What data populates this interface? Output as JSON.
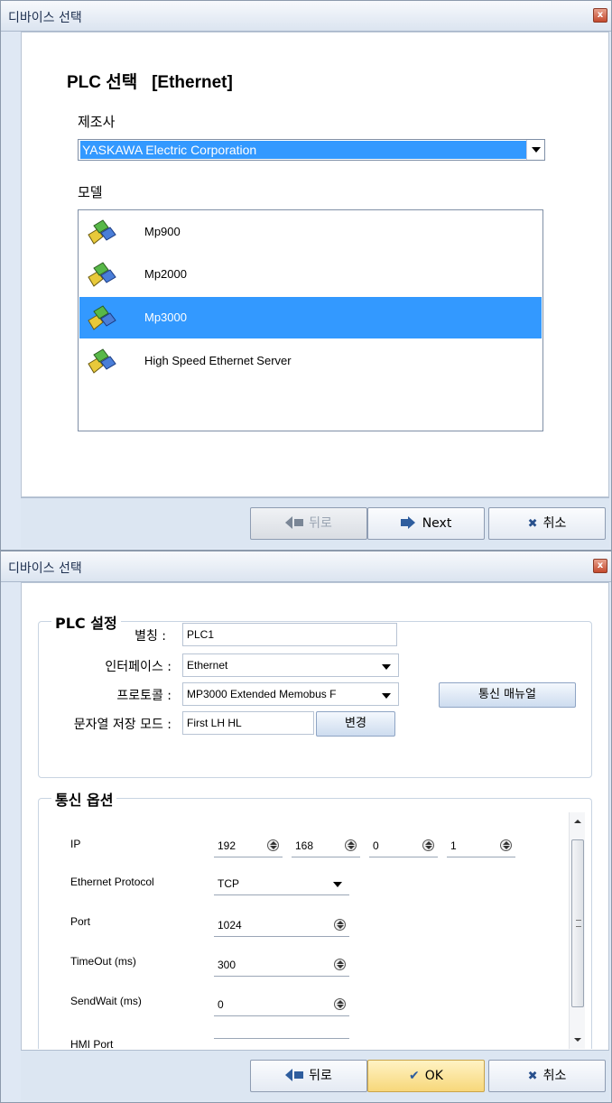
{
  "window1": {
    "title": "디바이스 선택",
    "heading": "PLC 선택   [Ethernet]",
    "manufacturer_label": "제조사",
    "manufacturer_value": "YASKAWA Electric Corporation",
    "model_label": "모델",
    "models": [
      {
        "name": "Mp900",
        "selected": false
      },
      {
        "name": "Mp2000",
        "selected": false
      },
      {
        "name": "Mp3000",
        "selected": true
      },
      {
        "name": "High Speed Ethernet Server",
        "selected": false
      }
    ],
    "buttons": {
      "back": "뒤로",
      "next": "Next",
      "cancel": "취소"
    }
  },
  "window2": {
    "title": "디바이스 선택",
    "plc_group_title": "PLC 설정",
    "alias_label": "별칭 :",
    "alias_value": "PLC1",
    "interface_label": "인터페이스 :",
    "interface_value": "Ethernet",
    "protocol_label": "프로토콜 :",
    "protocol_value": "MP3000 Extended Memobus F",
    "manual_button": "통신 매뉴얼",
    "string_mode_label": "문자열 저장 모드 :",
    "string_mode_value": "First LH HL",
    "change_button": "변경",
    "comm_group_title": "통신 옵션",
    "options": {
      "ip_label": "IP",
      "ip": [
        "192",
        "168",
        "0",
        "1"
      ],
      "eth_protocol_label": "Ethernet Protocol",
      "eth_protocol_value": "TCP",
      "port_label": "Port",
      "port_value": "1024",
      "timeout_label": "TimeOut (ms)",
      "timeout_value": "300",
      "sendwait_label": "SendWait (ms)",
      "sendwait_value": "0",
      "hmiport_label": "HMI Port"
    },
    "buttons": {
      "back": "뒤로",
      "ok": "OK",
      "cancel": "취소"
    }
  },
  "colors": {
    "selection": "#3399ff",
    "accent": "#2e5d9e"
  }
}
